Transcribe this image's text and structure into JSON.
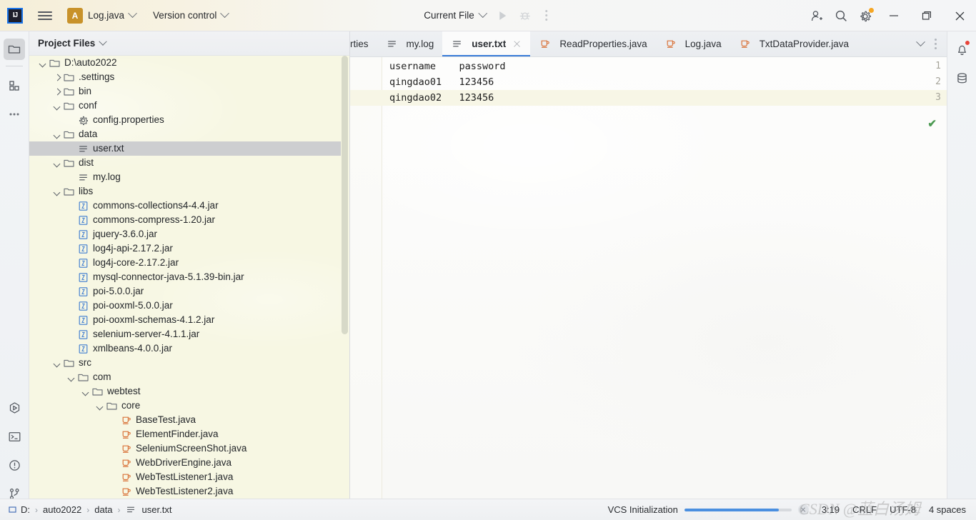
{
  "titlebar": {
    "logo_text": "IJ",
    "menu_icon": "hamburger-icon",
    "project_badge": "A",
    "project_name": "Log.java",
    "vcs_label": "Version control",
    "run_config": "Current File",
    "icons": [
      "run-icon",
      "debug-icon",
      "more-icon",
      "add-user-icon",
      "search-icon",
      "settings-icon"
    ],
    "window_minimize": "—",
    "window_maximize": "❐",
    "window_close": "✕"
  },
  "left_strip": {
    "items": [
      {
        "name": "project-files-icon",
        "active": true
      },
      {
        "name": "structure-icon",
        "active": false
      },
      {
        "name": "more-tool-windows-icon",
        "active": false
      }
    ],
    "bottom_items": [
      {
        "name": "run-tool-icon"
      },
      {
        "name": "terminal-icon"
      },
      {
        "name": "problems-icon"
      },
      {
        "name": "version-control-icon"
      }
    ]
  },
  "right_strip": {
    "items": [
      {
        "name": "notifications-icon",
        "badge": true
      },
      {
        "name": "database-icon",
        "badge": false
      }
    ]
  },
  "project_panel": {
    "title": "Project Files",
    "tree": [
      {
        "label": "D:\\auto2022",
        "depth": 0,
        "arrow": "down",
        "icon": "folder",
        "selected": false
      },
      {
        "label": ".settings",
        "depth": 1,
        "arrow": "right",
        "icon": "folder",
        "selected": false
      },
      {
        "label": "bin",
        "depth": 1,
        "arrow": "right",
        "icon": "folder",
        "selected": false
      },
      {
        "label": "conf",
        "depth": 1,
        "arrow": "down",
        "icon": "folder",
        "selected": false
      },
      {
        "label": "config.properties",
        "depth": 2,
        "arrow": "none",
        "icon": "properties",
        "selected": false
      },
      {
        "label": "data",
        "depth": 1,
        "arrow": "down",
        "icon": "folder",
        "selected": false
      },
      {
        "label": "user.txt",
        "depth": 2,
        "arrow": "none",
        "icon": "text",
        "selected": true
      },
      {
        "label": "dist",
        "depth": 1,
        "arrow": "down",
        "icon": "folder",
        "selected": false
      },
      {
        "label": "my.log",
        "depth": 2,
        "arrow": "none",
        "icon": "text",
        "selected": false
      },
      {
        "label": "libs",
        "depth": 1,
        "arrow": "down",
        "icon": "folder",
        "selected": false
      },
      {
        "label": "commons-collections4-4.4.jar",
        "depth": 2,
        "arrow": "none",
        "icon": "jar",
        "selected": false
      },
      {
        "label": "commons-compress-1.20.jar",
        "depth": 2,
        "arrow": "none",
        "icon": "jar",
        "selected": false
      },
      {
        "label": "jquery-3.6.0.jar",
        "depth": 2,
        "arrow": "none",
        "icon": "jar",
        "selected": false
      },
      {
        "label": "log4j-api-2.17.2.jar",
        "depth": 2,
        "arrow": "none",
        "icon": "jar",
        "selected": false
      },
      {
        "label": "log4j-core-2.17.2.jar",
        "depth": 2,
        "arrow": "none",
        "icon": "jar",
        "selected": false
      },
      {
        "label": "mysql-connector-java-5.1.39-bin.jar",
        "depth": 2,
        "arrow": "none",
        "icon": "jar",
        "selected": false
      },
      {
        "label": "poi-5.0.0.jar",
        "depth": 2,
        "arrow": "none",
        "icon": "jar",
        "selected": false
      },
      {
        "label": "poi-ooxml-5.0.0.jar",
        "depth": 2,
        "arrow": "none",
        "icon": "jar",
        "selected": false
      },
      {
        "label": "poi-ooxml-schemas-4.1.2.jar",
        "depth": 2,
        "arrow": "none",
        "icon": "jar",
        "selected": false
      },
      {
        "label": "selenium-server-4.1.1.jar",
        "depth": 2,
        "arrow": "none",
        "icon": "jar",
        "selected": false
      },
      {
        "label": "xmlbeans-4.0.0.jar",
        "depth": 2,
        "arrow": "none",
        "icon": "jar",
        "selected": false
      },
      {
        "label": "src",
        "depth": 1,
        "arrow": "down",
        "icon": "folder",
        "selected": false
      },
      {
        "label": "com",
        "depth": 2,
        "arrow": "down",
        "icon": "folder",
        "selected": false
      },
      {
        "label": "webtest",
        "depth": 3,
        "arrow": "down",
        "icon": "folder",
        "selected": false
      },
      {
        "label": "core",
        "depth": 4,
        "arrow": "down",
        "icon": "folder",
        "selected": false
      },
      {
        "label": "BaseTest.java",
        "depth": 5,
        "arrow": "none",
        "icon": "java",
        "selected": false
      },
      {
        "label": "ElementFinder.java",
        "depth": 5,
        "arrow": "none",
        "icon": "java",
        "selected": false
      },
      {
        "label": "SeleniumScreenShot.java",
        "depth": 5,
        "arrow": "none",
        "icon": "java",
        "selected": false
      },
      {
        "label": "WebDriverEngine.java",
        "depth": 5,
        "arrow": "none",
        "icon": "java",
        "selected": false
      },
      {
        "label": "WebTestListener1.java",
        "depth": 5,
        "arrow": "none",
        "icon": "java",
        "selected": false
      },
      {
        "label": "WebTestListener2.java",
        "depth": 5,
        "arrow": "none",
        "icon": "java",
        "selected": false
      }
    ]
  },
  "editor": {
    "tabs": [
      {
        "label": "rties",
        "icon": "properties",
        "active": false,
        "clipped": true
      },
      {
        "label": "my.log",
        "icon": "text",
        "active": false,
        "clipped": false
      },
      {
        "label": "user.txt",
        "icon": "text",
        "active": true,
        "clipped": false,
        "closable": true
      },
      {
        "label": "ReadProperties.java",
        "icon": "java",
        "active": false,
        "clipped": false
      },
      {
        "label": "Log.java",
        "icon": "java",
        "active": false,
        "clipped": false
      },
      {
        "label": "TxtDataProvider.java",
        "icon": "java",
        "active": false,
        "clipped": false
      }
    ],
    "tabbar_actions": [
      "chevron-down-icon",
      "more-icon"
    ],
    "lines": [
      {
        "number": "1",
        "text": "username    password"
      },
      {
        "number": "2",
        "text": "qingdao01   123456"
      },
      {
        "number": "3",
        "text": "qingdao02   123456"
      }
    ],
    "caret_line": 3,
    "inspection_status": "✔"
  },
  "statusbar": {
    "breadcrumb": [
      {
        "label": "D:",
        "icon": "drive"
      },
      {
        "label": "auto2022",
        "icon": "none"
      },
      {
        "label": "data",
        "icon": "none"
      },
      {
        "label": "user.txt",
        "icon": "text"
      }
    ],
    "task_label": "VCS Initialization",
    "progress_percent": 88,
    "caret_position": "3:19",
    "line_separator": "CRLF",
    "encoding": "UTF-8",
    "indent": "4 spaces",
    "watermark": "CSDN @蓝白汤姆"
  },
  "colors": {
    "accent_blue": "#3b7dd8",
    "java_orange": "#d9733a",
    "jar_blue": "#3f7dd0",
    "folder_gray": "#6b7077",
    "selection_gray": "#cdced0",
    "tree_bg": "#f7f7e3",
    "notification_red": "#e8443a",
    "gear_badge": "#f5a623",
    "ok_green": "#4c9a52"
  }
}
